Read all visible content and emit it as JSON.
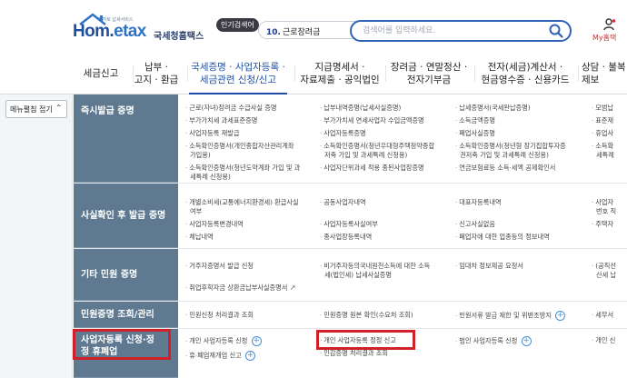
{
  "header": {
    "logo_tagline": "전자로 납세서비스",
    "logo_brand_a": "Hom",
    "logo_brand_b": "etax",
    "logo_dot": ".",
    "logo_korean": "국세청홈택스",
    "popular_badge": "인기검색어",
    "popular_num": "10.",
    "popular_term": "근로장려금",
    "search_placeholder": "검색어를 입력하세요.",
    "my_label": "My홈택"
  },
  "nav": {
    "items": [
      {
        "label_1": "세금신고",
        "label_2": ""
      },
      {
        "label_1": "납부 ·",
        "label_2": "고지 · 환급"
      },
      {
        "label_1": "국세증명 · 사업자등록 ·",
        "label_2": "세금관련 신청/신고"
      },
      {
        "label_1": "지급명세서 ·",
        "label_2": "자료제출 · 공익법인"
      },
      {
        "label_1": "장려금 · 연말정산 ·",
        "label_2": "전자기부금"
      },
      {
        "label_1": "전자(세금)계산서 ·",
        "label_2": "현금영수증 · 신용카드"
      },
      {
        "label_1": "상담 · 불복",
        "label_2": "제보"
      }
    ]
  },
  "left": {
    "menu_toggle": "메뉴펼침 접기"
  },
  "menu": {
    "rows": [
      {
        "category": "즉시발급 증명",
        "columns": [
          [
            "근로(자녀)장려금 수급사실 증명",
            "부가가치세 과세표준증명",
            "사업자등록 재발급",
            "소득확인증명서(개인종합자산관리계좌",
            "가입용)",
            "소득확인증명서(청년도약계좌 가입 및 과",
            "세특례 신청용)"
          ],
          [
            "납부내역증명(납세사실증명)",
            "부가가치세 면세사업자 수입금액증명",
            "사업자등록증명",
            "소득확인증명서(청년우대형주택청약종합",
            "저축 가입 및 과세특례 신청용)",
            "사업자단위과세 적용 종된사업장증명"
          ],
          [
            "납세증명서(국세완납증명)",
            "소득금액증명",
            "폐업사실증명",
            "소득확인증명서(청년형 장기집합투자증",
            "권저축 가입 및 과세특례 신청용)",
            "연금보험료등 소득·세액 공제확인서"
          ],
          [
            "모범납",
            "표준재",
            "휴업사",
            "소득확",
            "세특례"
          ]
        ]
      },
      {
        "category": "사실확인 후 발급 증명",
        "columns": [
          [
            "개별소비세(교통에너지환경세) 환급사실",
            "여부",
            "사업자등록변경내역",
            "체납내역"
          ],
          [
            "공동사업자내역",
            "사업자등록사실여부",
            "종사업장등록내역"
          ],
          [
            "대표자등록내역",
            "신고사실없음",
            "폐업자에 대한 업종등의 정보내역"
          ],
          [
            "사업자",
            "번호 직",
            "주택자"
          ]
        ]
      },
      {
        "category": "기타 민원 증명",
        "columns": [
          [
            "거주자증명서 발급 신청",
            "취업후학자금 상환금납부사실증명서"
          ],
          [
            "비거주자등의국내원천소득에 대한 소득",
            "세(법인세) 납세사실증명"
          ],
          [
            "임대차 정보제공 요청서"
          ],
          [
            "(공직선",
            "산세 납"
          ]
        ]
      },
      {
        "category": "민원증명 조회/관리",
        "columns": [
          [
            "민원신청 처리결과 조회"
          ],
          [
            "민원증명 원본 확인(수요처 조회)"
          ],
          [
            "민원서류 발급 제한 및 위변조방지"
          ],
          [
            "세무서"
          ]
        ]
      },
      {
        "category": "사업자등록 신청·정정 휴폐업",
        "columns": [
          [
            "개인 사업자등록 신청",
            "휴·폐업재개업 신고"
          ],
          [
            "개인 사업자등록 정정 신고",
            "인감증명 처리결과 조회"
          ],
          [
            "법인 사업자등록 신청"
          ],
          [
            "개인 신"
          ]
        ]
      }
    ]
  }
}
